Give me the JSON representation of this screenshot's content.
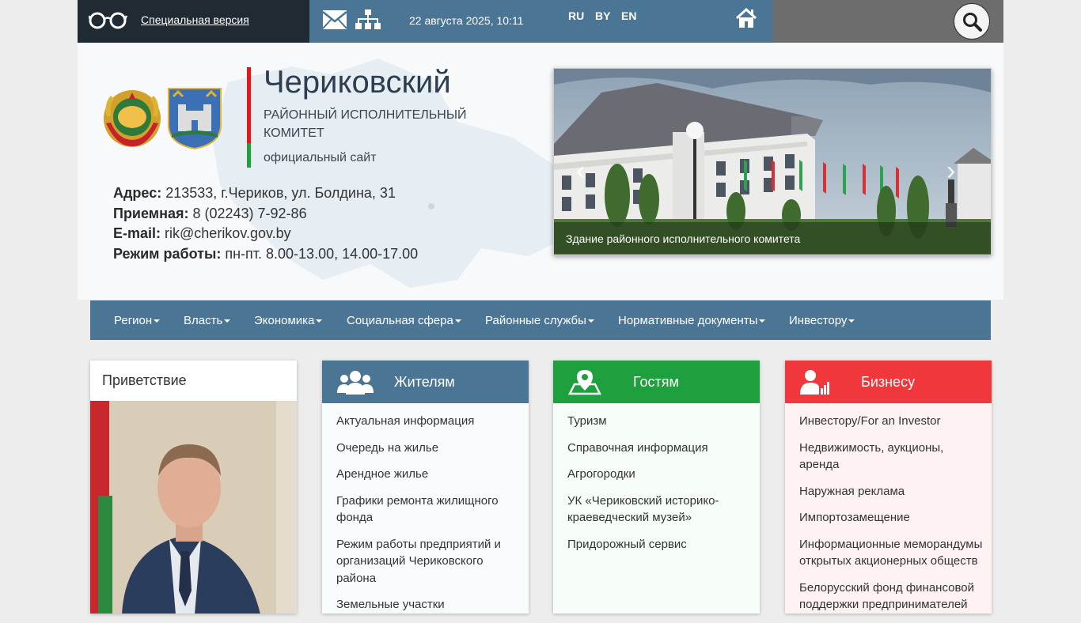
{
  "topbar": {
    "special_version": "Специальная версия",
    "datetime": "22 августа 2025, 10:11",
    "languages": [
      "RU",
      "BY",
      "EN"
    ]
  },
  "header": {
    "title": "Чериковский",
    "subtitle": "РАЙОННЫЙ ИСПОЛНИТЕЛЬНЫЙ КОМИТЕТ",
    "official": "официальный сайт",
    "contacts": {
      "address_label": "Адрес:",
      "address": "213533, г.Чериков, ул. Болдина, 31",
      "reception_label": "Приемная:",
      "reception": "8 (02243) 7-92-86",
      "email_label": "E-mail:",
      "email": "rik@cherikov.gov.by",
      "hours_label": "Режим работы:",
      "hours": "пн-пт. 8.00-13.00, 14.00-17.00"
    }
  },
  "slider": {
    "caption": "Здание районного исполнительного комитета"
  },
  "nav": {
    "items": [
      "Регион",
      "Власть",
      "Экономика",
      "Социальная сфера",
      "Районные службы",
      "Нормативные документы",
      "Инвестору"
    ]
  },
  "greeting": {
    "title": "Приветствие"
  },
  "cards": {
    "residents": {
      "title": "Жителям",
      "color": "#4b7595",
      "items": [
        "Актуальная информация",
        "Очередь на жилье",
        "Арендное жилье",
        "Графики ремонта жилищного фонда",
        "Режим работы предприятий и организаций Чериковского района",
        "Земельные участки"
      ]
    },
    "guests": {
      "title": "Гостям",
      "color": "#1fa03f",
      "items": [
        "Туризм",
        "Справочная информация",
        "Агрогородки",
        "УК «Чериковский историко-краеведческий музей»",
        "Придорожный сервис"
      ]
    },
    "business": {
      "title": "Бизнесу",
      "color": "#f0373b",
      "items": [
        "Инвестору/For an Investor",
        "Недвижимость, аукционы, аренда",
        "Наружная реклама",
        "Импортозамещение",
        "Информационные меморандумы открытых акционерных обществ",
        "Белорусский фонд финансовой поддержки предпринимателей"
      ]
    }
  }
}
